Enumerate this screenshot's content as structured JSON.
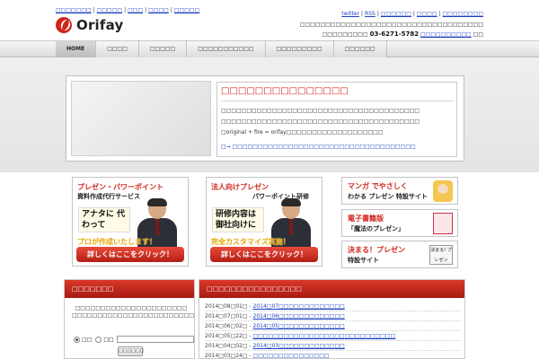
{
  "top_links": [
    "□□□□□□□",
    "□□□□□",
    "□□□",
    "□□□□",
    "□□□□□"
  ],
  "logo_text": "Orifay",
  "right_links": [
    "twitter",
    "RSS",
    "□□□□□□",
    "□□□□",
    "□□□□□□□□"
  ],
  "company_line": "□□□□□□□□□□□□□□□□□□□□□□□□□□□□□□□□□□□□",
  "phone_label": "□□□□□□□□□",
  "phone_number": "03-6271-5782",
  "phone_link": "□□□□□□□□□□",
  "phone_suffix": "□□",
  "nav": [
    "HOME",
    "□□□□",
    "□□□□□",
    "□□□□□□□□□□□",
    "□□□□□□□□□",
    "□□□□□□"
  ],
  "hero": {
    "title": "□□□□□□□□□□□□□□□",
    "paragraph_lines": [
      "□□□□□□□□□□□□□□□□□□□□□□□□□□□□□□□□□□□□□□□",
      "□□□□□□□□□□□□□□□□□□□□□□□□□□□□□□□□□□□□□□□",
      "□original + fire = orifay□□□□□□□□□□□□□□□□□□□"
    ],
    "more_link": "□→ □□□□□□□□□□□□□□□□□□□□□□□□□□□□□□□□□□□□"
  },
  "banners": [
    {
      "line1": "プレゼン・パワーポイント",
      "line2": "資料作成代行サービス",
      "bubble": "アナタに 代わって",
      "strip": "プロが作成いたします！",
      "cta": "詳しくはここをクリック！"
    },
    {
      "line1": "法人向けプレゼン",
      "line2": "パワーポイント研修",
      "bubble": "研修内容は 御社向けに",
      "strip": "完全カスタマイズ実施！",
      "cta": "詳しくはここをクリック！"
    }
  ],
  "side_banners": [
    {
      "line1": "マンガ でやさしく",
      "line2": "わかる プレゼン 特設サイト"
    },
    {
      "line1": "電子書籍版",
      "line2": "「魔法のプレゼン」"
    },
    {
      "line1": "決まる！プレゼン",
      "line2": "特設サイト"
    }
  ],
  "side_banner_mini": "決まる! プレゼン",
  "login_panel": {
    "title": "□□□□□□□",
    "note_line1": "□□□□□□□□□□□□□□□□□□□□□□",
    "note_line2": "□□□□□□□□□□□□□□□□□□□□□□□□□□□□□□□□□□□□□□",
    "radio1": "□□",
    "radio2": "□□",
    "submit": "□□□□□□"
  },
  "news_panel": {
    "title": "□□□□□□□□□□□□□□□□",
    "items": [
      {
        "date": "2014□08□01□ - ",
        "title": "2014□07□□□□□□□□□□□□□"
      },
      {
        "date": "2014□07□01□ - ",
        "title": "2014□06□□□□□□□□□□□□□"
      },
      {
        "date": "2014□06□02□ - ",
        "title": "2014□05□□□□□□□□□□□□□"
      },
      {
        "date": "2014□05□22□ - ",
        "title": "□□□□□□□□□□□□□□□□□□□□□□□□□□□□"
      },
      {
        "date": "2014□04□02□ - ",
        "title": "2014□03□□□□□□□□□□□□□"
      },
      {
        "date": "2014□03□24□ - ",
        "title": "□□□□□□□□□□□□□□□"
      }
    ]
  },
  "colors": {
    "brand_red": "#d0251b",
    "link_blue": "#1a3fbf",
    "accent_yellow": "#e8a400"
  }
}
